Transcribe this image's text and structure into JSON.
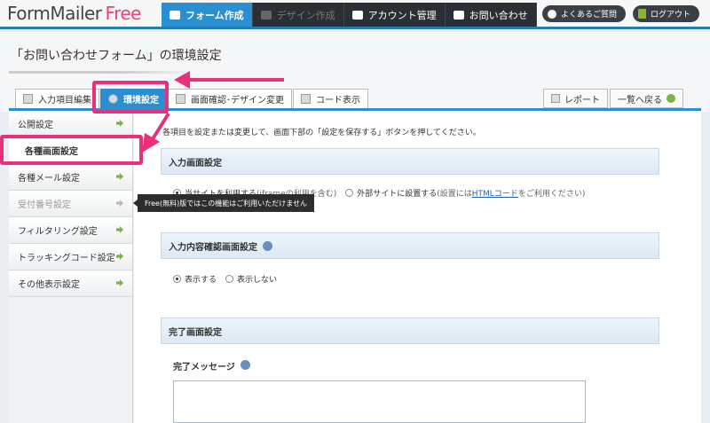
{
  "app": {
    "logo_main": "FormMailer",
    "logo_free": "Free"
  },
  "topnav": [
    {
      "label": "フォーム作成",
      "state": "active",
      "icon": "form-icon"
    },
    {
      "label": "デザイン作成",
      "state": "disabled",
      "icon": "design-icon"
    },
    {
      "label": "アカウント管理",
      "state": "normal",
      "icon": "user-icon"
    },
    {
      "label": "お問い合わせ",
      "state": "normal",
      "icon": "mail-icon"
    }
  ],
  "toplinks": {
    "faq": "よくあるご質問",
    "logout": "ログアウト"
  },
  "page": {
    "title": "「お問い合わせフォーム」の環境設定"
  },
  "tabs": [
    {
      "label": "入力項目編集",
      "active": false
    },
    {
      "label": "環境設定",
      "active": true
    },
    {
      "label": "画面確認･デザイン変更",
      "active": false
    },
    {
      "label": "コード表示",
      "active": false
    }
  ],
  "right_tabs": {
    "report": "レポート",
    "back": "一覧へ戻る"
  },
  "sidebar": {
    "items": [
      {
        "label": "公開設定"
      },
      {
        "label": "各種画面設定"
      },
      {
        "label": "各種メール設定"
      },
      {
        "label": "受付番号設定"
      },
      {
        "label": "フィルタリング設定"
      },
      {
        "label": "トラッキングコード設定"
      },
      {
        "label": "その他表示設定"
      }
    ]
  },
  "tooltip": {
    "text": "Free(無料)版ではこの機能はご利用いただけません"
  },
  "main": {
    "intro": "各項目を設定または変更して、画面下部の「設定を保存する」ボタンを押してください。",
    "section1": {
      "title": "入力画面設定",
      "opt1": "当サイトを利用する",
      "opt1_note": "(iframeの利用を含む)",
      "opt2": "外部サイトに設置する",
      "opt2_note_a": "(設置には",
      "opt2_link": "HTMLコード",
      "opt2_note_b": "をご利用ください)"
    },
    "section2": {
      "title": "入力内容確認画面設定",
      "opt1": "表示する",
      "opt2": "表示しない"
    },
    "section3": {
      "title": "完了画面設定",
      "message_label": "完了メッセージ"
    }
  },
  "colors": {
    "accent": "#2a8fd0",
    "highlight": "#e8317a",
    "brand_free": "#e8417c"
  }
}
